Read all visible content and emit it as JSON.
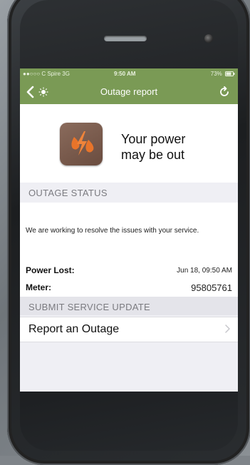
{
  "status_bar": {
    "carrier": "●●○○○ C Spire  3G",
    "time": "9:50 AM",
    "battery": "73%"
  },
  "navbar": {
    "title": "Outage report",
    "back_icon": "chevron-left-icon",
    "logo_icon": "sun-logo-icon",
    "refresh_icon": "refresh-icon"
  },
  "hero": {
    "icon": "power-outage-icon",
    "line1": "Your power",
    "line2": "may be out"
  },
  "outage_status": {
    "header": "OUTAGE STATUS",
    "message": "We are working to resolve the issues with your service."
  },
  "details": {
    "power_lost_label": "Power Lost:",
    "power_lost_value": "Jun 18, 09:50 AM",
    "meter_label": "Meter:",
    "meter_value": "95805761"
  },
  "submit": {
    "header": "SUBMIT SERVICE UPDATE",
    "report_label": "Report an Outage"
  },
  "colors": {
    "nav_green": "#7a9a55",
    "icon_brown": "#7a5b4d",
    "icon_orange": "#e8742a"
  }
}
